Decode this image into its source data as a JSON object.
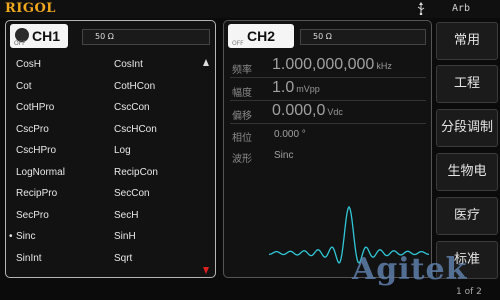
{
  "header": {
    "brand": "RIGOL",
    "mode": "Arb"
  },
  "ch1": {
    "title": "CH1",
    "state": "OFF",
    "impedance": "50 Ω",
    "waveforms": [
      [
        "CosH",
        "CosInt"
      ],
      [
        "Cot",
        "CotHCon"
      ],
      [
        "CotHPro",
        "CscCon"
      ],
      [
        "CscPro",
        "CscHCon"
      ],
      [
        "CscHPro",
        "Log"
      ],
      [
        "LogNormal",
        "RecipCon"
      ],
      [
        "RecipPro",
        "SecCon"
      ],
      [
        "SecPro",
        "SecH"
      ],
      [
        "Sinc",
        "SinH"
      ],
      [
        "SinInt",
        "Sqrt"
      ]
    ],
    "selected": "Sinc"
  },
  "ch2": {
    "title": "CH2",
    "state": "OFF",
    "impedance": "50 Ω",
    "params": {
      "freq_label": "频率",
      "freq_value": "1.000,000,000",
      "freq_unit": "kHz",
      "amp_label": "幅度",
      "amp_value": "1.0",
      "amp_unit": "mVpp",
      "offset_label": "偏移",
      "offset_value": "0.000,0",
      "offset_unit": "Vdc",
      "phase_label": "相位",
      "phase_value": "0.000 °",
      "shape_label": "波形",
      "shape_value": "Sinc"
    },
    "preview_color": "#30c8d8"
  },
  "softkeys": [
    "常用",
    "工程",
    "分段调制",
    "生物电",
    "医疗",
    "标准"
  ],
  "page_indicator": "1 of 2",
  "watermark": "Agitek",
  "colors": {
    "brand": "#f0a81c",
    "scroll_down": "#e02020",
    "waveform": "#30c8d8"
  }
}
